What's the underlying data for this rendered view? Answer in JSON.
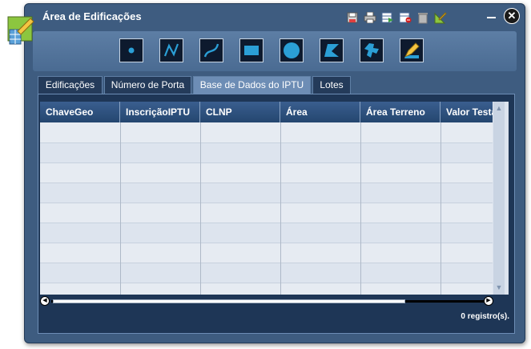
{
  "window": {
    "title": "Área de Edificações",
    "toolbar_icons": [
      "save-icon",
      "print-icon",
      "export-table-icon",
      "remove-layer-icon",
      "trash-icon",
      "ruler-icon"
    ],
    "minimize_label": "_",
    "close_label": "✕"
  },
  "draw_tools": [
    "point-tool-icon",
    "polyline-tool-icon",
    "curve-tool-icon",
    "rectangle-tool-icon",
    "circle-tool-icon",
    "polygon-tool-icon",
    "freehand-tool-icon",
    "edit-pencil-tool-icon"
  ],
  "tabs": [
    {
      "label": "Edificações",
      "active": false
    },
    {
      "label": "Número de Porta",
      "active": false
    },
    {
      "label": "Base de Dados do IPTU",
      "active": true
    },
    {
      "label": "Lotes",
      "active": false
    }
  ],
  "table": {
    "columns": [
      "ChaveGeo",
      "InscriçãoIPTU",
      "CLNP",
      "Área",
      "Área Terreno",
      "Valor Testada"
    ],
    "rows": []
  },
  "status": {
    "record_count": "0 registro(s)."
  },
  "colors": {
    "window_bg": "#3e5c80",
    "header_bg": "#24466f",
    "grid_bg": "#dde4ee",
    "tool_accent": "#2b9fd6"
  }
}
